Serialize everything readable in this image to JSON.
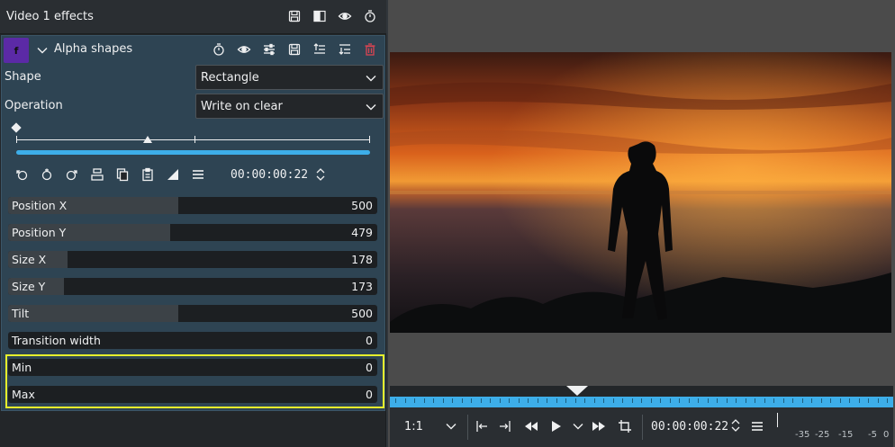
{
  "effects_panel": {
    "title": "Video 1 effects",
    "header_icons": [
      "save-stack-icon",
      "compare-split-icon",
      "eye-icon",
      "timer-icon"
    ]
  },
  "effect": {
    "badge": "f",
    "name": "Alpha shapes",
    "header_icons": [
      "timer-icon",
      "eye-icon",
      "adjust-icon",
      "save-icon",
      "move-up-icon",
      "move-down-icon",
      "delete-icon"
    ],
    "shape_label": "Shape",
    "shape_value": "Rectangle",
    "operation_label": "Operation",
    "operation_value": "Write on clear",
    "keyframe_timecode": "00:00:00:22",
    "params": [
      {
        "label": "Position X",
        "value": "500",
        "fill": 0.46
      },
      {
        "label": "Position Y",
        "value": "479",
        "fill": 0.44
      },
      {
        "label": "Size X",
        "value": "178",
        "fill": 0.16
      },
      {
        "label": "Size Y",
        "value": "173",
        "fill": 0.15
      },
      {
        "label": "Tilt",
        "value": "500",
        "fill": 0.46
      },
      {
        "label": "Transition width",
        "value": "0",
        "fill": 0
      },
      {
        "label": "Min",
        "value": "0",
        "fill": 0
      },
      {
        "label": "Max",
        "value": "0",
        "fill": 0
      }
    ]
  },
  "monitor": {
    "zoom": "1:1",
    "timecode": "00:00:00:22",
    "meter_labels": [
      "-35",
      "-25",
      "-15",
      "-5",
      "0"
    ]
  },
  "colors": {
    "accent": "#3daee9",
    "highlight": "#e6ef2c",
    "effect_badge": "#5b2aa6",
    "delete": "#da4453"
  }
}
